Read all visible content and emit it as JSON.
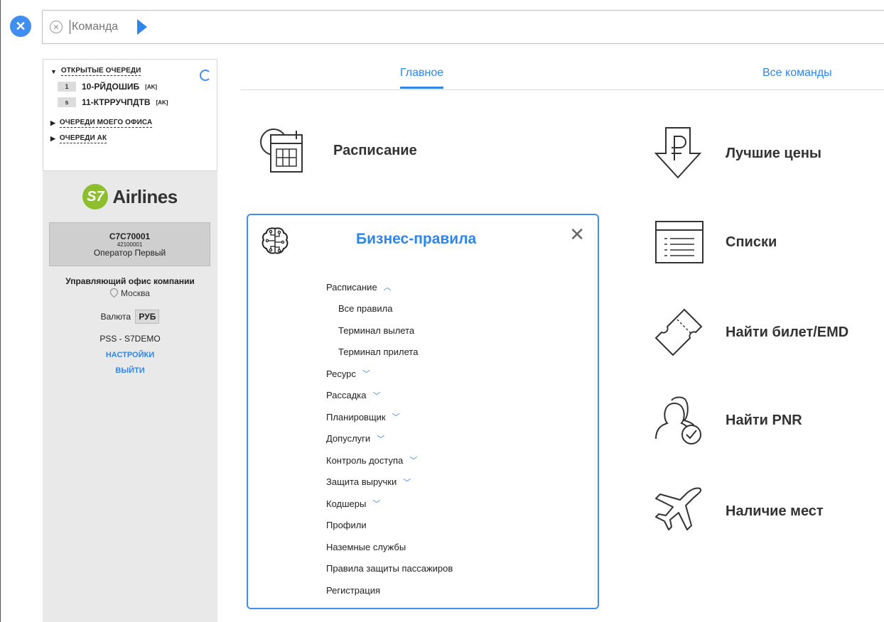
{
  "command_bar": {
    "placeholder": "Команда"
  },
  "queues": {
    "open_label": "ОТКРЫТЫЕ ОЧЕРЕДИ",
    "items": [
      {
        "badge": "1",
        "name": "10-РЙДОШИБ",
        "tag": "[AK]"
      },
      {
        "badge": "s",
        "name": "11-КТРРУЧПДТВ",
        "tag": "[AK]"
      }
    ],
    "office_label": "ОЧЕРЕДИ МОЕГО ОФИСА",
    "ak_label": "ОЧЕРЕДИ АК"
  },
  "logo": {
    "badge": "S7",
    "text": "Airlines"
  },
  "user": {
    "code": "C7C70001",
    "number": "42100001",
    "name": "Оператор Первый"
  },
  "office": {
    "title": "Управляющий офис компании",
    "city": "Москва"
  },
  "currency": {
    "label": "Валюта",
    "value": "РУБ"
  },
  "system": "PSS - S7DEMO",
  "links": {
    "settings": "НАСТРОЙКИ",
    "logout": "ВЫЙТИ"
  },
  "tabs": {
    "main": "Главное",
    "all": "Все команды"
  },
  "tiles": {
    "schedule": "Расписание",
    "best_prices": "Лучшие цены",
    "lists": "Списки",
    "find_ticket": "Найти билет/EMD",
    "find_pnr": "Найти PNR",
    "availability": "Наличие мест"
  },
  "panel": {
    "title": "Бизнес-правила",
    "rules": [
      {
        "label": "Расписание",
        "chevron": "︿",
        "sub": false
      },
      {
        "label": "Все правила",
        "chevron": "",
        "sub": true
      },
      {
        "label": "Терминал вылета",
        "chevron": "",
        "sub": true
      },
      {
        "label": "Терминал прилета",
        "chevron": "",
        "sub": true
      },
      {
        "label": "Ресурс",
        "chevron": "﹀",
        "sub": false
      },
      {
        "label": "Рассадка",
        "chevron": "﹀",
        "sub": false
      },
      {
        "label": "Планировщик",
        "chevron": "﹀",
        "sub": false
      },
      {
        "label": "Допуслуги",
        "chevron": "﹀",
        "sub": false
      },
      {
        "label": "Контроль доступа",
        "chevron": "﹀",
        "sub": false
      },
      {
        "label": "Защита выручки",
        "chevron": "﹀",
        "sub": false
      },
      {
        "label": "Кодшеры",
        "chevron": "﹀",
        "sub": false
      },
      {
        "label": "Профили",
        "chevron": "",
        "sub": false
      },
      {
        "label": "Наземные службы",
        "chevron": "",
        "sub": false
      },
      {
        "label": "Правила защиты пассажиров",
        "chevron": "",
        "sub": false
      },
      {
        "label": "Регистрация",
        "chevron": "",
        "sub": false
      }
    ]
  },
  "colors": {
    "accent": "#2f86ea",
    "logo_green": "#8dbe2e"
  }
}
